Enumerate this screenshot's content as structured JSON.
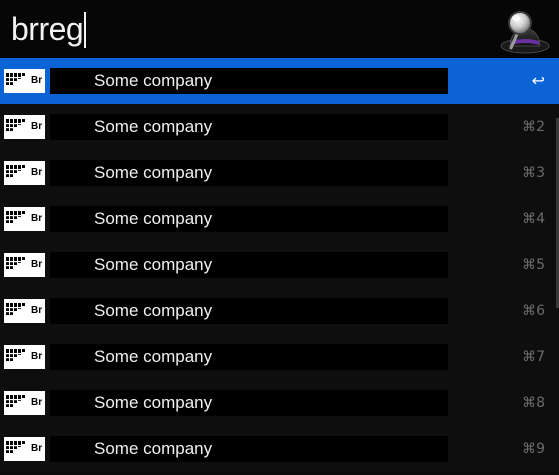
{
  "search": {
    "query": "brreg"
  },
  "app_icon": "alfred-hat-magnifier-icon",
  "results": [
    {
      "title": "Some company",
      "icon_label": "Br",
      "shortcut": "↩",
      "selected": true
    },
    {
      "title": "Some company",
      "icon_label": "Br",
      "shortcut": "⌘2",
      "selected": false
    },
    {
      "title": "Some company",
      "icon_label": "Br",
      "shortcut": "⌘3",
      "selected": false
    },
    {
      "title": "Some company",
      "icon_label": "Br",
      "shortcut": "⌘4",
      "selected": false
    },
    {
      "title": "Some company",
      "icon_label": "Br",
      "shortcut": "⌘5",
      "selected": false
    },
    {
      "title": "Some company",
      "icon_label": "Br",
      "shortcut": "⌘6",
      "selected": false
    },
    {
      "title": "Some company",
      "icon_label": "Br",
      "shortcut": "⌘7",
      "selected": false
    },
    {
      "title": "Some company",
      "icon_label": "Br",
      "shortcut": "⌘8",
      "selected": false
    },
    {
      "title": "Some company",
      "icon_label": "Br",
      "shortcut": "⌘9",
      "selected": false
    }
  ],
  "colors": {
    "selection": "#0b63d6",
    "background": "#0b0b0b",
    "text": "#f0f0f0",
    "shortcut": "#6b6b6b"
  }
}
